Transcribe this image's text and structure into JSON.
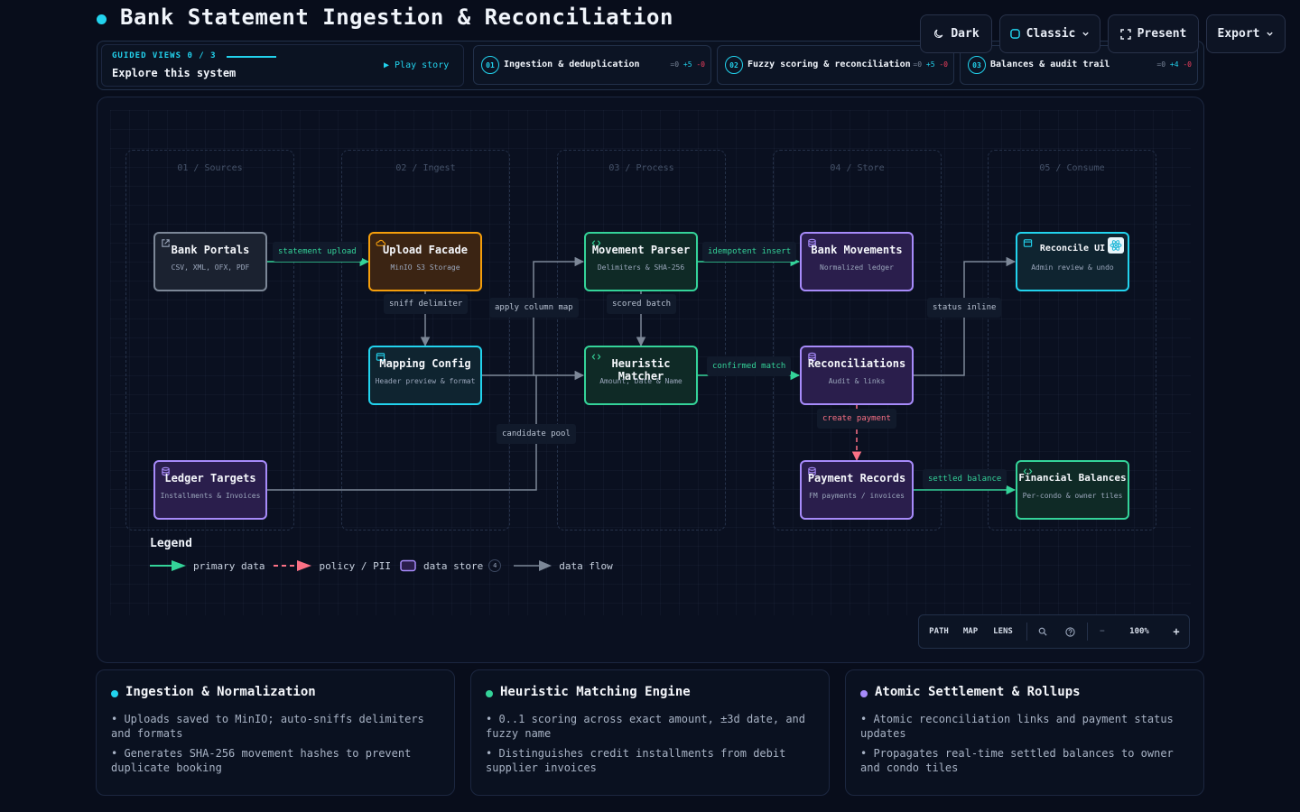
{
  "page": {
    "title": "Bank Statement Ingestion & Reconciliation"
  },
  "topbar": {
    "dark_label": "Dark",
    "classic_label": "Classic",
    "present_label": "Present",
    "export_label": "Export"
  },
  "guided": {
    "label": "GUIDED VIEWS 0 / 3",
    "title": "Explore this system",
    "play_label": "▶ Play story",
    "steps": [
      {
        "num": "01",
        "title": "Ingestion & deduplication",
        "eq": "=0",
        "plus": "+5",
        "minus": "-0"
      },
      {
        "num": "02",
        "title": "Fuzzy scoring & reconciliation",
        "eq": "=0",
        "plus": "+5",
        "minus": "-0"
      },
      {
        "num": "03",
        "title": "Balances & audit trail",
        "eq": "=0",
        "plus": "+4",
        "minus": "-0"
      }
    ]
  },
  "diagram": {
    "columns": [
      "01 / Sources",
      "02 / Ingest",
      "03 / Process",
      "04 / Store",
      "05 / Consume"
    ],
    "nodes": {
      "bank_portals": {
        "title": "Bank Portals",
        "sub": "CSV, XML, OFX, PDF"
      },
      "ledger_targets": {
        "title": "Ledger Targets",
        "sub": "Installments & Invoices"
      },
      "upload_facade": {
        "title": "Upload Facade",
        "sub": "MinIO S3 Storage"
      },
      "mapping_config": {
        "title": "Mapping Config",
        "sub": "Header preview & format"
      },
      "movement_parser": {
        "title": "Movement Parser",
        "sub": "Delimiters & SHA-256"
      },
      "heuristic_matcher": {
        "title": "Heuristic Matcher",
        "sub": "Amount, Date & Name"
      },
      "bank_movements": {
        "title": "Bank Movements",
        "sub": "Normalized ledger"
      },
      "reconciliations": {
        "title": "Reconciliations",
        "sub": "Audit & links"
      },
      "payment_records": {
        "title": "Payment Records",
        "sub": "FM payments / invoices"
      },
      "reconcile_ui": {
        "title": "Reconcile UI",
        "sub": "Admin review & undo"
      },
      "financial_balances": {
        "title": "Financial Balances",
        "sub": "Per-condo & owner tiles"
      }
    },
    "edges": {
      "statement_upload": "statement upload",
      "sniff_delimiter": "sniff delimiter",
      "apply_column_map": "apply column map",
      "idempotent_insert": "idempotent insert",
      "scored_batch": "scored batch",
      "confirmed_match": "confirmed match",
      "candidate_pool": "candidate pool",
      "status_inline": "status inline",
      "create_payment": "create payment",
      "settled_balance": "settled balance"
    },
    "colors": {
      "primary": "#34d399",
      "policy": "#fb7185",
      "store": "#a78bfa",
      "flow": "#7c8797",
      "accent": "#22d3ee"
    }
  },
  "legend": {
    "title": "Legend",
    "primary": "primary data",
    "policy": "policy / PII",
    "store": "data store",
    "store_count": "4",
    "flow": "data flow"
  },
  "toolbar": {
    "path": "PATH",
    "map": "MAP",
    "lens": "LENS",
    "zoom_out": "−",
    "zoom": "100%",
    "zoom_in": "+"
  },
  "cards": [
    {
      "title": "Ingestion & Normalization",
      "color": "#22d3ee",
      "bullets": [
        "• Uploads saved to MinIO; auto-sniffs delimiters and formats",
        "• Generates SHA-256 movement hashes to prevent duplicate booking"
      ]
    },
    {
      "title": "Heuristic Matching Engine",
      "color": "#34d399",
      "bullets": [
        "• 0..1 scoring across exact amount, ±3d date, and fuzzy name",
        "• Distinguishes credit installments from debit supplier invoices"
      ]
    },
    {
      "title": "Atomic Settlement & Rollups",
      "color": "#a78bfa",
      "bullets": [
        "• Atomic reconciliation links and payment status updates",
        "• Propagates real-time settled balances to owner and condo tiles"
      ]
    }
  ]
}
